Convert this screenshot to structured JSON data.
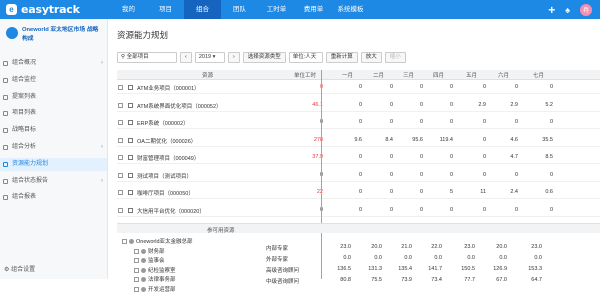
{
  "app": {
    "brand": "easytrack",
    "logo_letter": "e"
  },
  "nav": [
    "我的",
    "项目",
    "组合",
    "团队",
    "工时单",
    "费用单",
    "系统模板"
  ],
  "active_nav": 2,
  "user": {
    "avatar": "冉"
  },
  "org": {
    "name": "Oneworld 亚太地区市场 战略构成"
  },
  "sidebar": {
    "items": [
      {
        "label": "组合概况"
      },
      {
        "label": "组合监控"
      },
      {
        "label": "提案列表"
      },
      {
        "label": "项目列表"
      },
      {
        "label": "战略目标"
      },
      {
        "label": "组合分析"
      },
      {
        "label": "资源能力规划"
      },
      {
        "label": "组合状态报告"
      },
      {
        "label": "组合报表"
      }
    ],
    "footer": "组合设置"
  },
  "page": {
    "title": "资源能力规划"
  },
  "toolbar": {
    "scope_select": "全部项目",
    "year": "2019",
    "resource_type_button": "选择资源类型",
    "unit_select": "单位:人天",
    "recalc_button": "重新计算",
    "zoom_in_button": "放大",
    "zoom_out_button": "缩小"
  },
  "grid": {
    "headers": {
      "resource": "资源",
      "workload": "单位工时",
      "months": [
        "一月",
        "二月",
        "三月",
        "四月",
        "五月",
        "六月",
        "七月"
      ]
    },
    "rows": [
      {
        "name": "ATM业务项目（000001）",
        "total": "0",
        "red": true,
        "m": [
          "0",
          "0",
          "0",
          "0",
          "0",
          "0",
          "0"
        ]
      },
      {
        "name": "ATM系统界面优化项目（000052）",
        "total": "46.1",
        "red": true,
        "m": [
          "0",
          "0",
          "0",
          "0",
          "2.9",
          "2.9",
          "5.2"
        ]
      },
      {
        "name": "ERP系统（000002）",
        "total": "0",
        "red": false,
        "m": [
          "0",
          "0",
          "0",
          "0",
          "0",
          "0",
          "0"
        ]
      },
      {
        "name": "OA二期优化（000026）",
        "total": "278",
        "red": true,
        "m": [
          "9.6",
          "8.4",
          "95.6",
          "119.4",
          "0",
          "4.6",
          "35.5"
        ]
      },
      {
        "name": "财富管理项目（000049）",
        "total": "37.9",
        "red": true,
        "m": [
          "0",
          "0",
          "0",
          "0",
          "0",
          "4.7",
          "8.5"
        ]
      },
      {
        "name": "测试项目（测试项目）",
        "total": "0",
        "red": false,
        "m": [
          "0",
          "0",
          "0",
          "0",
          "0",
          "0",
          "0"
        ]
      },
      {
        "name": "咖啡厅项目（000050）",
        "total": "22",
        "red": true,
        "m": [
          "0",
          "0",
          "0",
          "5",
          "11",
          "2.4",
          "0.6"
        ]
      },
      {
        "name": "大信用平台优化（000020）",
        "total": "0",
        "red": false,
        "m": [
          "0",
          "0",
          "0",
          "0",
          "0",
          "0",
          "0"
        ]
      }
    ]
  },
  "resources": {
    "header": "参可用资源",
    "tree": [
      {
        "label": "Oneworld亚太金融总部",
        "level": 0
      },
      {
        "label": "财务部",
        "level": 1
      },
      {
        "label": "监事会",
        "level": 1
      },
      {
        "label": "纪检监察室",
        "level": 1
      },
      {
        "label": "法律事务部",
        "level": 1
      },
      {
        "label": "开发运营部",
        "level": 1
      }
    ],
    "roles": [
      {
        "name": "内部专家",
        "m": [
          "23.0",
          "20.0",
          "21.0",
          "22.0",
          "23.0",
          "20.0",
          "23.0"
        ]
      },
      {
        "name": "外部专家",
        "m": [
          "0.0",
          "0.0",
          "0.0",
          "0.0",
          "0.0",
          "0.0",
          "0.0"
        ]
      },
      {
        "name": "高级咨询顾问",
        "m": [
          "136.5",
          "131.3",
          "135.4",
          "141.7",
          "150.5",
          "126.9",
          "153.3"
        ]
      },
      {
        "name": "中级咨询顾问",
        "m": [
          "80.8",
          "75.5",
          "73.9",
          "73.4",
          "77.7",
          "67.0",
          "64.7"
        ]
      }
    ]
  }
}
